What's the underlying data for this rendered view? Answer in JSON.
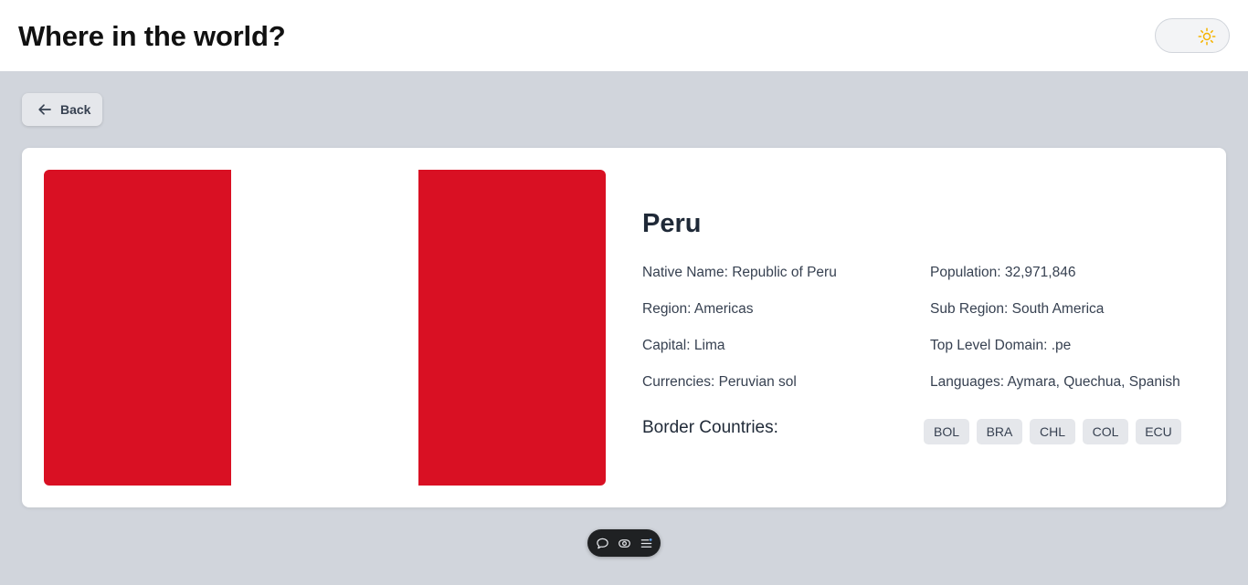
{
  "header": {
    "title": "Where in the world?",
    "theme_icon": "sun-icon"
  },
  "back_button": {
    "label": "Back",
    "icon": "arrow-left-icon"
  },
  "country": {
    "name": "Peru",
    "flag": {
      "colors": [
        "#d91023",
        "#ffffff",
        "#d91023"
      ]
    },
    "details_left": [
      {
        "label": "Native Name:",
        "value": "Republic of Peru"
      },
      {
        "label": "Region:",
        "value": "Americas"
      },
      {
        "label": "Capital:",
        "value": "Lima"
      },
      {
        "label": "Currencies:",
        "value": "Peruvian sol"
      }
    ],
    "details_right": [
      {
        "label": "Population:",
        "value": "32,971,846"
      },
      {
        "label": "Sub Region:",
        "value": "South America"
      },
      {
        "label": "Top Level Domain:",
        "value": ".pe"
      },
      {
        "label": "Languages:",
        "value": "Aymara, Quechua, Spanish"
      }
    ],
    "border_label": "Border Countries:",
    "border_countries": [
      "BOL",
      "BRA",
      "CHL",
      "COL",
      "ECU"
    ]
  },
  "toolbar": {
    "icons": [
      "comment-icon",
      "eye-icon",
      "menu-icon"
    ]
  },
  "colors": {
    "accent_sun": "#f5b301",
    "background": "#d1d5dc"
  }
}
